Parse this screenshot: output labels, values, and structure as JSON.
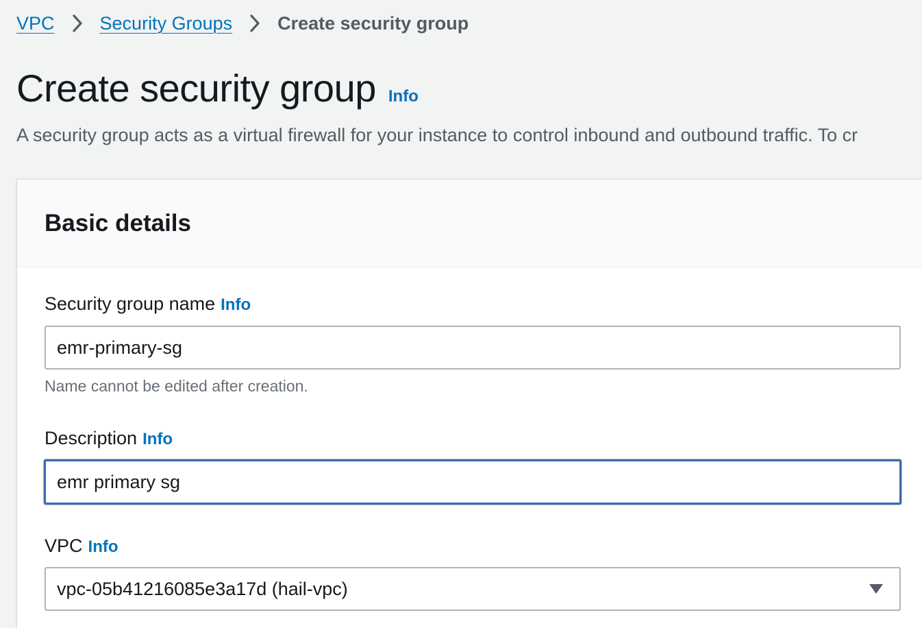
{
  "breadcrumb": {
    "items": [
      {
        "label": "VPC"
      },
      {
        "label": "Security Groups"
      }
    ],
    "current": "Create security group"
  },
  "page": {
    "title": "Create security group",
    "info_label": "Info",
    "description": "A security group acts as a virtual firewall for your instance to control inbound and outbound traffic. To cr"
  },
  "basic_details": {
    "title": "Basic details",
    "name_field": {
      "label": "Security group name",
      "info_label": "Info",
      "value": "emr-primary-sg",
      "help": "Name cannot be edited after creation."
    },
    "description_field": {
      "label": "Description",
      "info_label": "Info",
      "value": "emr primary sg"
    },
    "vpc_field": {
      "label": "VPC",
      "info_label": "Info",
      "selected": "vpc-05b41216085e3a17d (hail-vpc)"
    }
  },
  "colors": {
    "link": "#0073bb",
    "focus_border": "#3e6ba8",
    "background": "#f2f3f3",
    "text_primary": "#16191f",
    "text_secondary": "#545b64"
  },
  "icons": {
    "breadcrumb_separator": "chevron-right-icon",
    "select_caret": "caret-down-icon"
  }
}
